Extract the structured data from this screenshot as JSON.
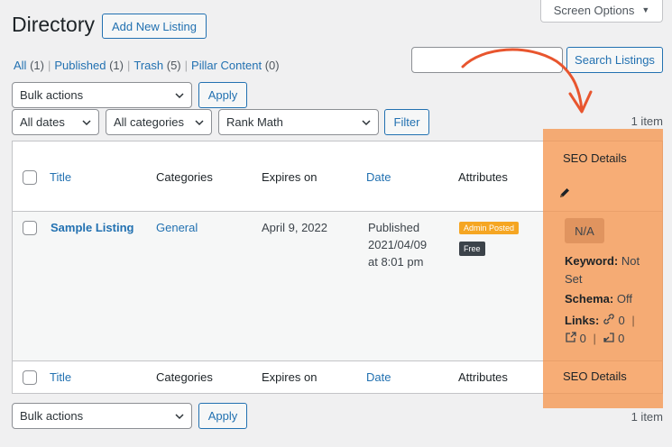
{
  "header": {
    "screen_options": "Screen Options",
    "title": "Directory",
    "add_new": "Add New Listing"
  },
  "filters_status": {
    "all": "All",
    "all_count": "(1)",
    "published": "Published",
    "published_count": "(1)",
    "trash": "Trash",
    "trash_count": "(5)",
    "pillar": "Pillar Content",
    "pillar_count": "(0)",
    "separator": "|"
  },
  "search": {
    "value": "",
    "button": "Search Listings"
  },
  "tablenav_top": {
    "bulk_actions": "Bulk actions",
    "apply": "Apply",
    "dates": "All dates",
    "categories": "All categories",
    "rank_math": "Rank Math",
    "filter": "Filter",
    "items": "1 item"
  },
  "table": {
    "columns": {
      "title": "Title",
      "categories": "Categories",
      "expires": "Expires on",
      "date": "Date",
      "attributes": "Attributes",
      "seo": "SEO Details"
    },
    "rows": [
      {
        "title": "Sample Listing",
        "category": "General",
        "expires": "April 9, 2022",
        "date_status": "Published",
        "date_value": "2021/04/09",
        "date_time": "at 8:01 pm",
        "badge_admin": "Admin Posted",
        "badge_free": "Free",
        "seo_score": "N/A",
        "keyword_label": "Keyword:",
        "keyword_value": "Not Set",
        "schema_label": "Schema:",
        "schema_value": "Off",
        "links_label": "Links:",
        "internal_links": "0",
        "external_links": "0",
        "incoming_links": "0",
        "links_sep": "|"
      }
    ]
  },
  "tablenav_bottom": {
    "bulk_actions": "Bulk actions",
    "apply": "Apply",
    "items": "1 item"
  },
  "colors": {
    "accent": "#2271b1",
    "highlight": "#f59650",
    "annotation_arrow": "#e8552e",
    "badge_admin": "#f5a623",
    "badge_free": "#3c434a"
  }
}
